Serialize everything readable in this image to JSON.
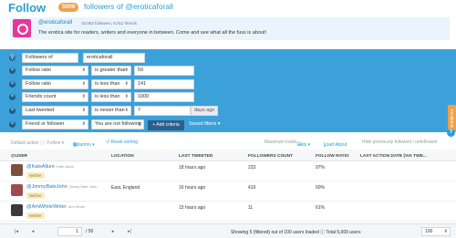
{
  "header": {
    "title": "Follow",
    "count_badge": "5000",
    "subtitle": "followers of @eroticaforall"
  },
  "profile": {
    "name": "@eroticaforall",
    "stats": "15,953 followers, 6,011 friends",
    "bio": "The erotica site for readers, writers and everyone in between. Come and see what all the fuss is about!"
  },
  "filters": {
    "rows": [
      {
        "field": "Followers of",
        "value": "eroticaforall"
      },
      {
        "field": "Follow ratio",
        "op": "is greater than",
        "value": "59"
      },
      {
        "field": "Follow ratio",
        "op": "is less than",
        "value": "141"
      },
      {
        "field": "Friends count",
        "op": "is less than",
        "value": "1000"
      },
      {
        "field": "Last tweeted",
        "op": "is newer than",
        "value": "7",
        "suffix": "days ago"
      },
      {
        "field": "Friend or follower",
        "op": "You are not following"
      }
    ],
    "add_criteria": "+ Add criteria",
    "saved_filters": "Saved filters ▾"
  },
  "side": {
    "feedback": "Feedback",
    "help": "?"
  },
  "toolbar": {
    "default_action": "Default action ⓘ: Follow ▾",
    "columns": "Columns ▾",
    "reset": "↺ Reset sorting",
    "maximum": "Maximum loads:",
    "lists": "Lists ▾",
    "load_about": "Load About",
    "hide_prev": "Hide previously followed / unfollowed"
  },
  "table": {
    "columns": [
      "@USER",
      "LOCATION",
      "LAST TWEETED",
      "FOLLOWERS COUNT",
      "FOLLOW RATIO",
      "LAST ACTION DATE (VIA TWE..."
    ],
    "rows": [
      {
        "user": "@KateAllure",
        "real": "Kate Allure",
        "badge": "Neither",
        "location": "",
        "last_tweeted": "18 hours ago",
        "followers": "233",
        "ratio": "97%"
      },
      {
        "user": "@JimmyBateJohn",
        "real": "Jimmy Bate John",
        "badge": "Neither",
        "location": "East, England",
        "last_tweeted": "16 hours ago",
        "followers": "419",
        "ratio": "60%"
      },
      {
        "user": "@AmiWhiteWriter",
        "real": "Ami White",
        "badge": "Neither",
        "location": "",
        "last_tweeted": "15 hours ago",
        "followers": "11",
        "ratio": "61%"
      }
    ]
  },
  "footer": {
    "first": "|◂",
    "prev": "◂",
    "page": "1",
    "total_pages": "/ 50",
    "next": "▸",
    "last": "▸|",
    "status": "Showing 5 (filtered) out of 100 users loaded ⓘ Total 5,000 users",
    "page_size": "100"
  },
  "colors": {
    "accent": "#2a9fd6",
    "filter_panel": "#3ca0d9",
    "badge": "#f0a04b",
    "add_button": "#2c5f8a"
  }
}
